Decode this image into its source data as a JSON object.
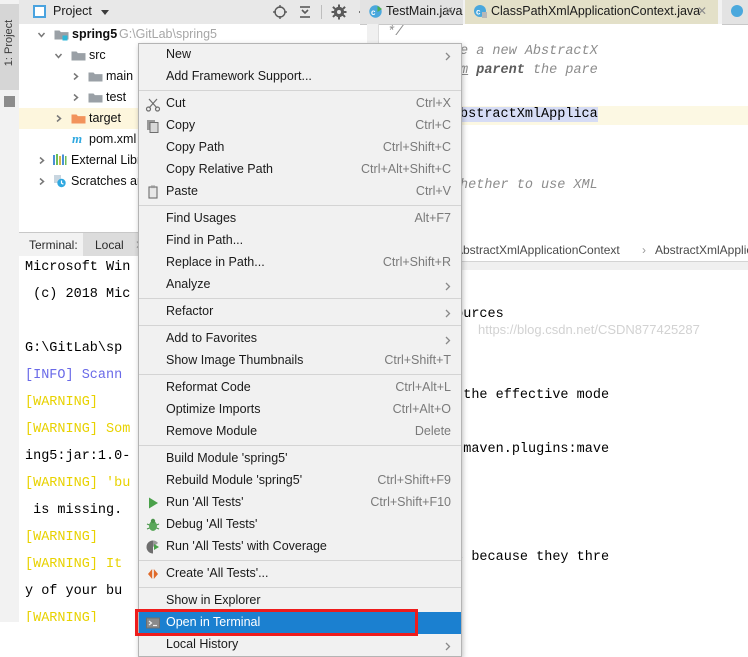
{
  "app": {
    "accent_blue": "#1b80d0",
    "highlight_red": "#ee1c1c",
    "watermark": "https://blog.csdn.net/CSDN877425287"
  },
  "project_panel": {
    "vertical_tab": "1: Project",
    "title": "Project",
    "toolbar_icons": [
      "locate-icon",
      "collapse-all-icon",
      "settings-gear-icon",
      "minimize-icon"
    ],
    "tree": [
      {
        "label": "spring5",
        "path": "G:\\GitLab\\spring5",
        "icon": "module-folder-icon",
        "expanded": true,
        "depth": 0,
        "bold": true,
        "selected": false
      },
      {
        "label": "src",
        "path": "",
        "icon": "folder-icon",
        "expanded": true,
        "depth": 1,
        "bold": false,
        "selected": false
      },
      {
        "label": "main",
        "path": "",
        "icon": "folder-icon",
        "expanded": false,
        "depth": 2,
        "bold": false,
        "selected": false
      },
      {
        "label": "test",
        "path": "",
        "icon": "folder-icon",
        "expanded": false,
        "depth": 2,
        "bold": false,
        "selected": false
      },
      {
        "label": "target",
        "path": "",
        "icon": "folder-orange-icon",
        "expanded": false,
        "depth": 1,
        "bold": false,
        "selected": true
      },
      {
        "label": "pom.xml",
        "path": "",
        "icon": "maven-pom-icon",
        "expanded": null,
        "depth": 2,
        "bold": false,
        "selected": false
      },
      {
        "label": "External Libraries",
        "path": "",
        "icon": "libraries-icon",
        "expanded": false,
        "depth": 0,
        "bold": false,
        "selected": false
      },
      {
        "label": "Scratches and Consoles",
        "path": "",
        "icon": "scratches-icon",
        "expanded": false,
        "depth": 0,
        "bold": false,
        "selected": false
      }
    ]
  },
  "terminal": {
    "label": "Terminal:",
    "tab": "Local",
    "close": "✕",
    "lines": [
      {
        "text": "Microsoft Win",
        "tokens": []
      },
      {
        "text": " (c) 2018 Mic",
        "tokens": []
      },
      {
        "text": "",
        "tokens": []
      },
      {
        "text": "G:\\GitLab\\sp",
        "tokens": []
      },
      {
        "text": "[INFO] Scann",
        "kind": "info"
      },
      {
        "text": "[WARNING]",
        "kind": "warn"
      },
      {
        "text": "[WARNING] Som",
        "kind": "warn"
      },
      {
        "text": "ing5:jar:1.0-",
        "tokens": []
      },
      {
        "text": "[WARNING] 'bu",
        "kind": "warn"
      },
      {
        "text": " is missing.",
        "tokens": []
      },
      {
        "text": "[WARNING]",
        "kind": "warn"
      },
      {
        "text": "[WARNING] It",
        "kind": "warn"
      },
      {
        "text": "y of your bu",
        "tokens": []
      },
      {
        "text": "[WARNING]",
        "kind": "warn"
      }
    ],
    "right_lines": [
      "lassifier=sources",
      "",
      "le building the effective mode",
      " org.apache.maven.plugins:mave",
      "",
      "ese problems because they thre"
    ]
  },
  "editor": {
    "tabs": [
      {
        "label": "TestMain.java",
        "icon": "java-class-run-icon",
        "active": false
      },
      {
        "label": "ClassPathXmlApplicationContext.java",
        "icon": "java-class-icon",
        "active": true
      }
    ],
    "code_lines": [
      " */",
      "   * Create a new AbstractX",
      "   * @param parent the pare",
      "   */",
      "  public AbstractXmlApplica",
      "",
      "  /**",
      "   * Set whether to use XML"
    ],
    "breadcrumb": [
      "AbstractXmlApplicationContext",
      "AbstractXmlApplic"
    ]
  },
  "context_menu": {
    "items": [
      {
        "label": "New",
        "accel": "",
        "icon": "",
        "arrow": true,
        "mnemonic": ""
      },
      {
        "label": "Add Framework Support...",
        "accel": "",
        "icon": "",
        "arrow": false,
        "mnemonic": ""
      },
      {
        "separator": true
      },
      {
        "label": "Cut",
        "accel": "Ctrl+X",
        "icon": "scissors-icon",
        "arrow": false,
        "mnemonic": "t"
      },
      {
        "label": "Copy",
        "accel": "Ctrl+C",
        "icon": "copy-icon",
        "arrow": false,
        "mnemonic": "C"
      },
      {
        "label": "Copy Path",
        "accel": "Ctrl+Shift+C",
        "icon": "",
        "arrow": false,
        "mnemonic": "o"
      },
      {
        "label": "Copy Relative Path",
        "accel": "Ctrl+Alt+Shift+C",
        "icon": "",
        "arrow": false,
        "mnemonic": "y"
      },
      {
        "label": "Paste",
        "accel": "Ctrl+V",
        "icon": "clipboard-icon",
        "arrow": false,
        "mnemonic": "P"
      },
      {
        "separator": true
      },
      {
        "label": "Find Usages",
        "accel": "Alt+F7",
        "icon": "",
        "arrow": false,
        "mnemonic": "U"
      },
      {
        "label": "Find in Path...",
        "accel": "",
        "icon": "",
        "arrow": false,
        "mnemonic": "P"
      },
      {
        "label": "Replace in Path...",
        "accel": "Ctrl+Shift+R",
        "icon": "",
        "arrow": false,
        "mnemonic": "a"
      },
      {
        "label": "Analyze",
        "accel": "",
        "icon": "",
        "arrow": true,
        "mnemonic": "z"
      },
      {
        "separator": true
      },
      {
        "label": "Refactor",
        "accel": "",
        "icon": "",
        "arrow": true,
        "mnemonic": "R"
      },
      {
        "separator": true
      },
      {
        "label": "Add to Favorites",
        "accel": "",
        "icon": "",
        "arrow": true,
        "mnemonic": "F"
      },
      {
        "label": "Show Image Thumbnails",
        "accel": "Ctrl+Shift+T",
        "icon": "",
        "arrow": false,
        "mnemonic": ""
      },
      {
        "separator": true
      },
      {
        "label": "Reformat Code",
        "accel": "Ctrl+Alt+L",
        "icon": "",
        "arrow": false,
        "mnemonic": "R"
      },
      {
        "label": "Optimize Imports",
        "accel": "Ctrl+Alt+O",
        "icon": "",
        "arrow": false,
        "mnemonic": "z"
      },
      {
        "label": "Remove Module",
        "accel": "Delete",
        "icon": "",
        "arrow": false,
        "mnemonic": ""
      },
      {
        "separator": true
      },
      {
        "label": "Build Module 'spring5'",
        "accel": "",
        "icon": "",
        "arrow": false,
        "mnemonic": "M"
      },
      {
        "label": "Rebuild Module 'spring5'",
        "accel": "Ctrl+Shift+F9",
        "icon": "",
        "arrow": false,
        "mnemonic": "e"
      },
      {
        "label": "Run 'All Tests'",
        "accel": "Ctrl+Shift+F10",
        "icon": "run-green-icon",
        "arrow": false,
        "mnemonic": "u"
      },
      {
        "label": "Debug 'All Tests'",
        "accel": "",
        "icon": "debug-bug-icon",
        "arrow": false,
        "mnemonic": "D"
      },
      {
        "label": "Run 'All Tests' with Coverage",
        "accel": "",
        "icon": "coverage-icon",
        "arrow": false,
        "mnemonic": "v"
      },
      {
        "separator": true
      },
      {
        "label": "Create 'All Tests'...",
        "accel": "",
        "icon": "create-config-icon",
        "arrow": false,
        "mnemonic": ""
      },
      {
        "separator": true
      },
      {
        "label": "Show in Explorer",
        "accel": "",
        "icon": "",
        "arrow": false,
        "mnemonic": "E"
      },
      {
        "label": "Open in Terminal",
        "accel": "",
        "icon": "terminal-icon",
        "arrow": false,
        "mnemonic": "",
        "selected": true,
        "highlighted": true
      },
      {
        "label": "Local History",
        "accel": "",
        "icon": "",
        "arrow": true,
        "mnemonic": "H"
      }
    ]
  }
}
